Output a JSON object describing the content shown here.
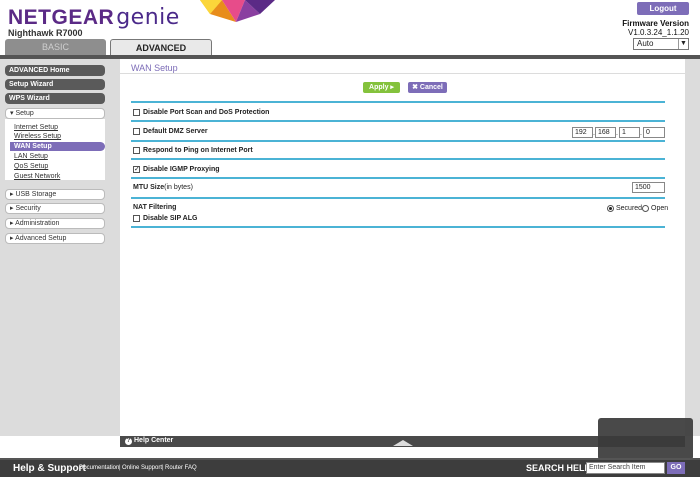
{
  "header": {
    "brand": "NETGEAR",
    "product": "genie",
    "model": "Nighthawk R7000",
    "logout_label": "Logout",
    "firmware_label": "Firmware Version",
    "firmware_value": "V1.0.3.24_1.1.20",
    "language_value": "Auto"
  },
  "tabs": {
    "basic": "BASIC",
    "advanced": "ADVANCED"
  },
  "sidebar": {
    "advanced_home": "ADVANCED Home",
    "setup_wizard": "Setup Wizard",
    "wps_wizard": "WPS Wizard",
    "setup": "▾ Setup",
    "setup_items": [
      "Internet Setup",
      "Wireless Setup",
      "WAN Setup",
      "LAN Setup",
      "QoS Setup",
      "Guest Network"
    ],
    "usb_storage": "▸ USB Storage",
    "security": "▸ Security",
    "administration": "▸ Administration",
    "advanced_setup": "▸ Advanced Setup"
  },
  "main": {
    "title": "WAN Setup",
    "apply_label": "Apply ▸",
    "cancel_label": "✖ Cancel",
    "disable_port_scan": "Disable Port Scan and DoS Protection",
    "default_dmz": "Default DMZ Server",
    "dmz_ip": [
      "192",
      "168",
      "1",
      "0"
    ],
    "respond_ping": "Respond to Ping on Internet Port",
    "disable_igmp": "Disable IGMP Proxying",
    "mtu_label": "MTU Size",
    "mtu_unit": "(in bytes)",
    "mtu_value": "1500",
    "nat_label": "NAT Filtering",
    "nat_secured": "Secured",
    "nat_open": "Open",
    "disable_sip": "Disable SIP ALG"
  },
  "bottom": {
    "help_center": "Help Center",
    "help_support": "Help & Support",
    "links": [
      "Documentation",
      "Online Support",
      "Router FAQ"
    ],
    "search_help": "SEARCH HELP",
    "search_placeholder": "Enter Search Item",
    "go": "GO"
  },
  "colors": {
    "accent": "#7d6db8",
    "apply": "#84c23c",
    "divider": "#4bb3d5"
  }
}
